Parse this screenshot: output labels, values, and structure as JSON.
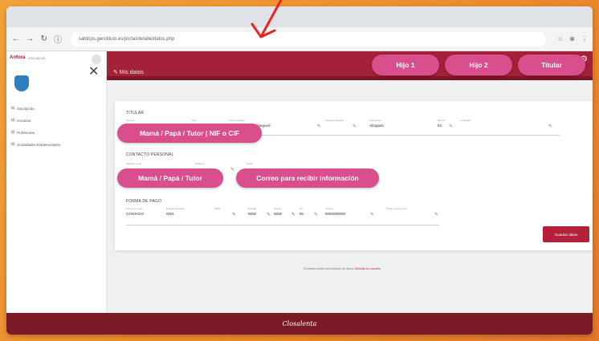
{
  "browser": {
    "url": "sabtrips.gerotitulo.es/portal/detalle/datos.php",
    "back": "←",
    "forward": "→",
    "reload": "↻",
    "site_info": "ⓘ",
    "icons": [
      "☆",
      "⊕",
      "⋮"
    ]
  },
  "sidebar": {
    "brand": "Anfora",
    "user": "ESCUELAS",
    "close_glyph": "✕",
    "items": [
      {
        "icon": "⊟",
        "label": "Inscripción"
      },
      {
        "icon": "⊟",
        "label": "Horarios"
      },
      {
        "icon": "⊟",
        "label": "Profesores"
      },
      {
        "icon": "⊟",
        "label": "Actividades Extraescolares"
      }
    ]
  },
  "header": {
    "title": "✎ Mis datos",
    "tabs": [
      "Hijo 1",
      "Hijo 2",
      "Titular"
    ],
    "gear": "⚙"
  },
  "form": {
    "titular_title": "TITULAR",
    "contact_title": "CONTACTO PERSONAL",
    "payment_title": "FORMA DE PAGO",
    "titular_fields": [
      {
        "label": "Nombre",
        "value": ""
      },
      {
        "label": "NIF",
        "value": ""
      },
      {
        "label": "Primer apellido",
        "value": "Lorena Abadía Isabegovic"
      },
      {
        "label": "Segundo apellido",
        "value": ""
      },
      {
        "label": "Parentesco",
        "value": "Abogado"
      },
      {
        "label": "Idioma",
        "value": "Es"
      },
      {
        "label": "Localidad",
        "value": ""
      }
    ],
    "contact_fields": [
      {
        "label": "Teléfono móvil",
        "value": ""
      },
      {
        "label": "Teléfono",
        "value": ""
      },
      {
        "label": "Email",
        "value": ""
      }
    ],
    "payment_fields": [
      {
        "label": "Forma de pago",
        "value": "CONTADO"
      },
      {
        "label": "Entidad bancaria",
        "value": "0001"
      },
      {
        "label": "IBAN",
        "value": ""
      },
      {
        "label": "Entidad",
        "value": "0000"
      },
      {
        "label": "Oficina",
        "value": "0000"
      },
      {
        "label": "DC",
        "value": "00"
      },
      {
        "label": "Cuenta",
        "value": "0000000000"
      },
      {
        "label": "Titular de la cuenta",
        "value": ""
      }
    ],
    "pencil": "✎",
    "save_label": "Guardar datos"
  },
  "callouts": {
    "titular": "Mamá / Papá / Tutor | NIF o CIF",
    "contact_name": "Mamá / Papá / Tutor",
    "email": "Correo para recibir información"
  },
  "footer": {
    "note": "Si desea recibir información de datos",
    "note_link": "Solicitar un usuario",
    "logo": "Closalenta"
  },
  "colors": {
    "accent": "#a4213a",
    "pill": "#d94f8d",
    "background": "#ec8a2c",
    "arrow": "#e8261f"
  }
}
